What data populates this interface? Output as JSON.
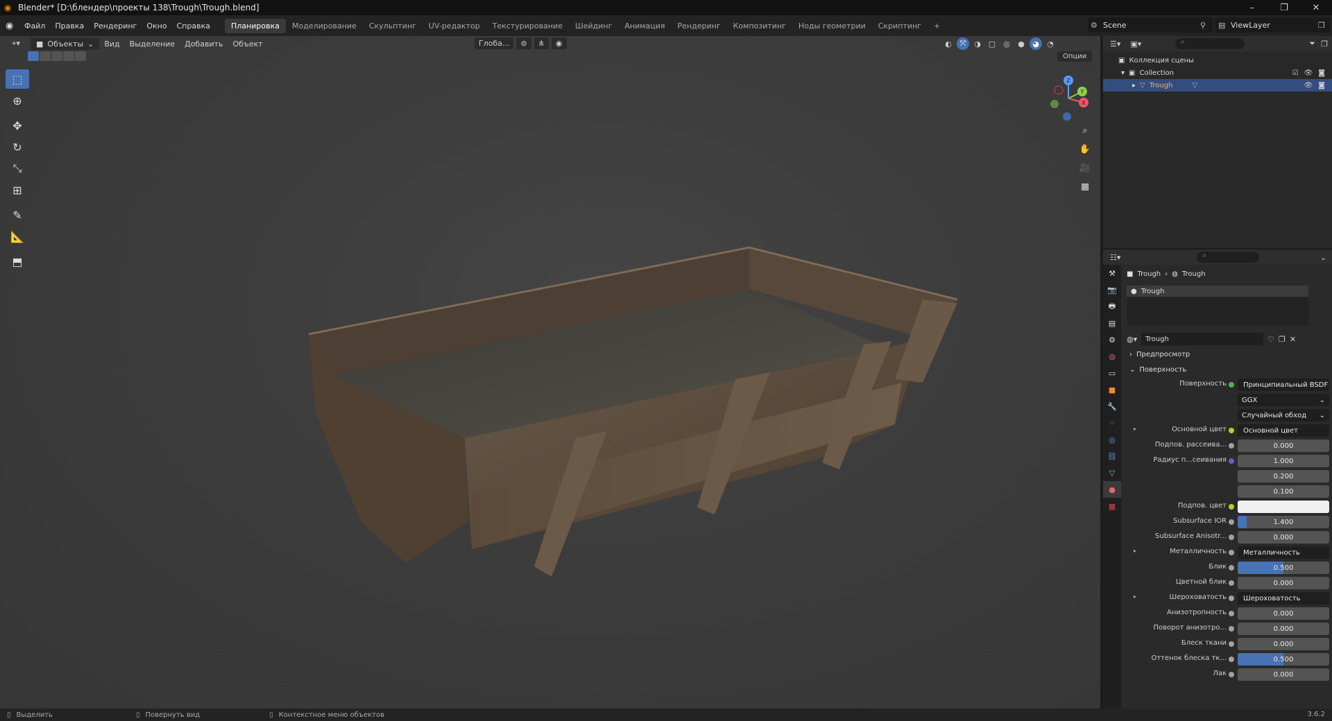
{
  "window": {
    "title": "Blender* [D:\\блендер\\проекты 138\\Trough\\Trough.blend]",
    "controls": [
      "–",
      "❐",
      "✕"
    ]
  },
  "menu": [
    "Файл",
    "Правка",
    "Рендеринг",
    "Окно",
    "Справка"
  ],
  "workspaces": [
    "Планировка",
    "Моделирование",
    "Скульптинг",
    "UV-редактор",
    "Текстурирование",
    "Шейдинг",
    "Анимация",
    "Рендеринг",
    "Композитинг",
    "Ноды геометрии",
    "Скриптинг",
    "+"
  ],
  "active_workspace": "Планировка",
  "scene": "Scene",
  "view_layer": "ViewLayer",
  "viewport": {
    "mode": "Объекты",
    "menus": [
      "Вид",
      "Выделение",
      "Добавить",
      "Объект"
    ],
    "orientation": "Глоба...",
    "options": "Опции",
    "gizmo_axes": [
      "X",
      "Y",
      "Z"
    ]
  },
  "outliner": {
    "root": "Коллекция сцены",
    "collection": "Collection",
    "object": "Trough"
  },
  "properties": {
    "breadcrumb_object": "Trough",
    "breadcrumb_material": "Trough",
    "slot": "Trough",
    "material_name": "Trough",
    "preview_panel": "Предпросмотр",
    "surface_panel": "Поверхность",
    "rows": [
      {
        "label": "Поверхность",
        "value": "Принципиальный BSDF",
        "kind": "dark",
        "dot": "#4cb34c"
      },
      {
        "label": "",
        "value": "GGX",
        "kind": "select"
      },
      {
        "label": "",
        "value": "Случайный обход",
        "kind": "select"
      },
      {
        "label": "Основной цвет",
        "value": "Основной цвет",
        "kind": "dark",
        "dot": "#c7c729",
        "arrow": true
      },
      {
        "label": "Подпов. рассеива...",
        "value": "0.000",
        "kind": "num",
        "dot": "#a1a1a1"
      },
      {
        "label": "Радиус п...сеивания",
        "value": "1.000",
        "kind": "num",
        "dot": "#6363c7"
      },
      {
        "label": "",
        "value": "0.200",
        "kind": "num"
      },
      {
        "label": "",
        "value": "0.100",
        "kind": "num"
      },
      {
        "label": "Подпов. цвет",
        "value": "",
        "kind": "white",
        "dot": "#c7c729"
      },
      {
        "label": "Subsurface IOR",
        "value": "1.400",
        "kind": "num",
        "dot": "#a1a1a1",
        "fill": 0.1
      },
      {
        "label": "Subsurface Anisotr...",
        "value": "0.000",
        "kind": "num",
        "dot": "#a1a1a1"
      },
      {
        "label": "Металличность",
        "value": "Металличность",
        "kind": "dark",
        "dot": "#a1a1a1",
        "arrow": true
      },
      {
        "label": "Блик",
        "value": "0.500",
        "kind": "num",
        "dot": "#a1a1a1",
        "fill": 0.5
      },
      {
        "label": "Цветной блик",
        "value": "0.000",
        "kind": "num",
        "dot": "#a1a1a1"
      },
      {
        "label": "Шероховатость",
        "value": "Шероховатость",
        "kind": "dark",
        "dot": "#a1a1a1",
        "arrow": true
      },
      {
        "label": "Анизотропность",
        "value": "0.000",
        "kind": "num",
        "dot": "#a1a1a1"
      },
      {
        "label": "Поворот анизотро...",
        "value": "0.000",
        "kind": "num",
        "dot": "#a1a1a1"
      },
      {
        "label": "Блеск ткани",
        "value": "0.000",
        "kind": "num",
        "dot": "#a1a1a1"
      },
      {
        "label": "Оттенок блеска тк...",
        "value": "0.500",
        "kind": "num",
        "dot": "#a1a1a1",
        "fill": 0.5
      },
      {
        "label": "Лак",
        "value": "0.000",
        "kind": "num",
        "dot": "#a1a1a1"
      }
    ]
  },
  "statusbar": {
    "select": "Выделить",
    "rotate": "Повернуть вид",
    "context": "Контекстное меню объектов",
    "version": "3.6.2"
  },
  "colors": {
    "accent": "#4772b3",
    "selected_row": "#334d80",
    "wood": "#5a4a3a"
  }
}
